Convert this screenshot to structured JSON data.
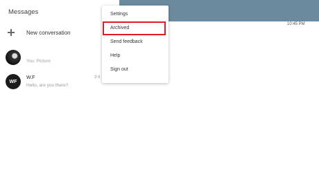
{
  "header": {
    "title": "Messages"
  },
  "actions": {
    "new_conversation": "New conversation"
  },
  "conversations": [
    {
      "name": "",
      "snippet": "You: Picture",
      "time": "",
      "avatar_text": "",
      "name_redacted": true
    },
    {
      "name": "W.F",
      "snippet": "Hello, are you there?",
      "time": "3:4",
      "avatar_text": "WF"
    }
  ],
  "menu": {
    "items": [
      {
        "label": "Settings"
      },
      {
        "label": "Archived",
        "highlighted": true
      },
      {
        "label": "Send feedback"
      },
      {
        "label": "Help"
      },
      {
        "label": "Sign out"
      }
    ],
    "highlight_color": "#e21a22"
  },
  "conversation_pane": {
    "timestamp": "10:45 PM",
    "header_color": "#6c8a9e"
  }
}
